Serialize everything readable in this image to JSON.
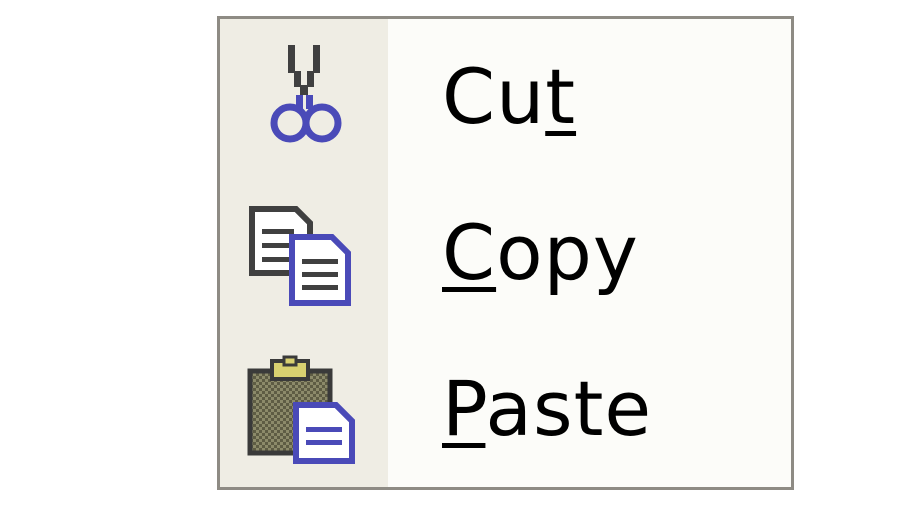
{
  "context_menu": {
    "items": [
      {
        "label": "Cut",
        "accel_index": 2,
        "icon": "scissors-icon"
      },
      {
        "label": "Copy",
        "accel_index": 0,
        "icon": "copy-icon"
      },
      {
        "label": "Paste",
        "accel_index": 0,
        "icon": "clipboard-paste-icon"
      }
    ]
  },
  "colors": {
    "border": "#8e8b84",
    "menu_bg": "#fcfcf9",
    "gutter_bg": "#efede4",
    "icon_blue": "#4a4ab8",
    "icon_dark": "#404040"
  }
}
